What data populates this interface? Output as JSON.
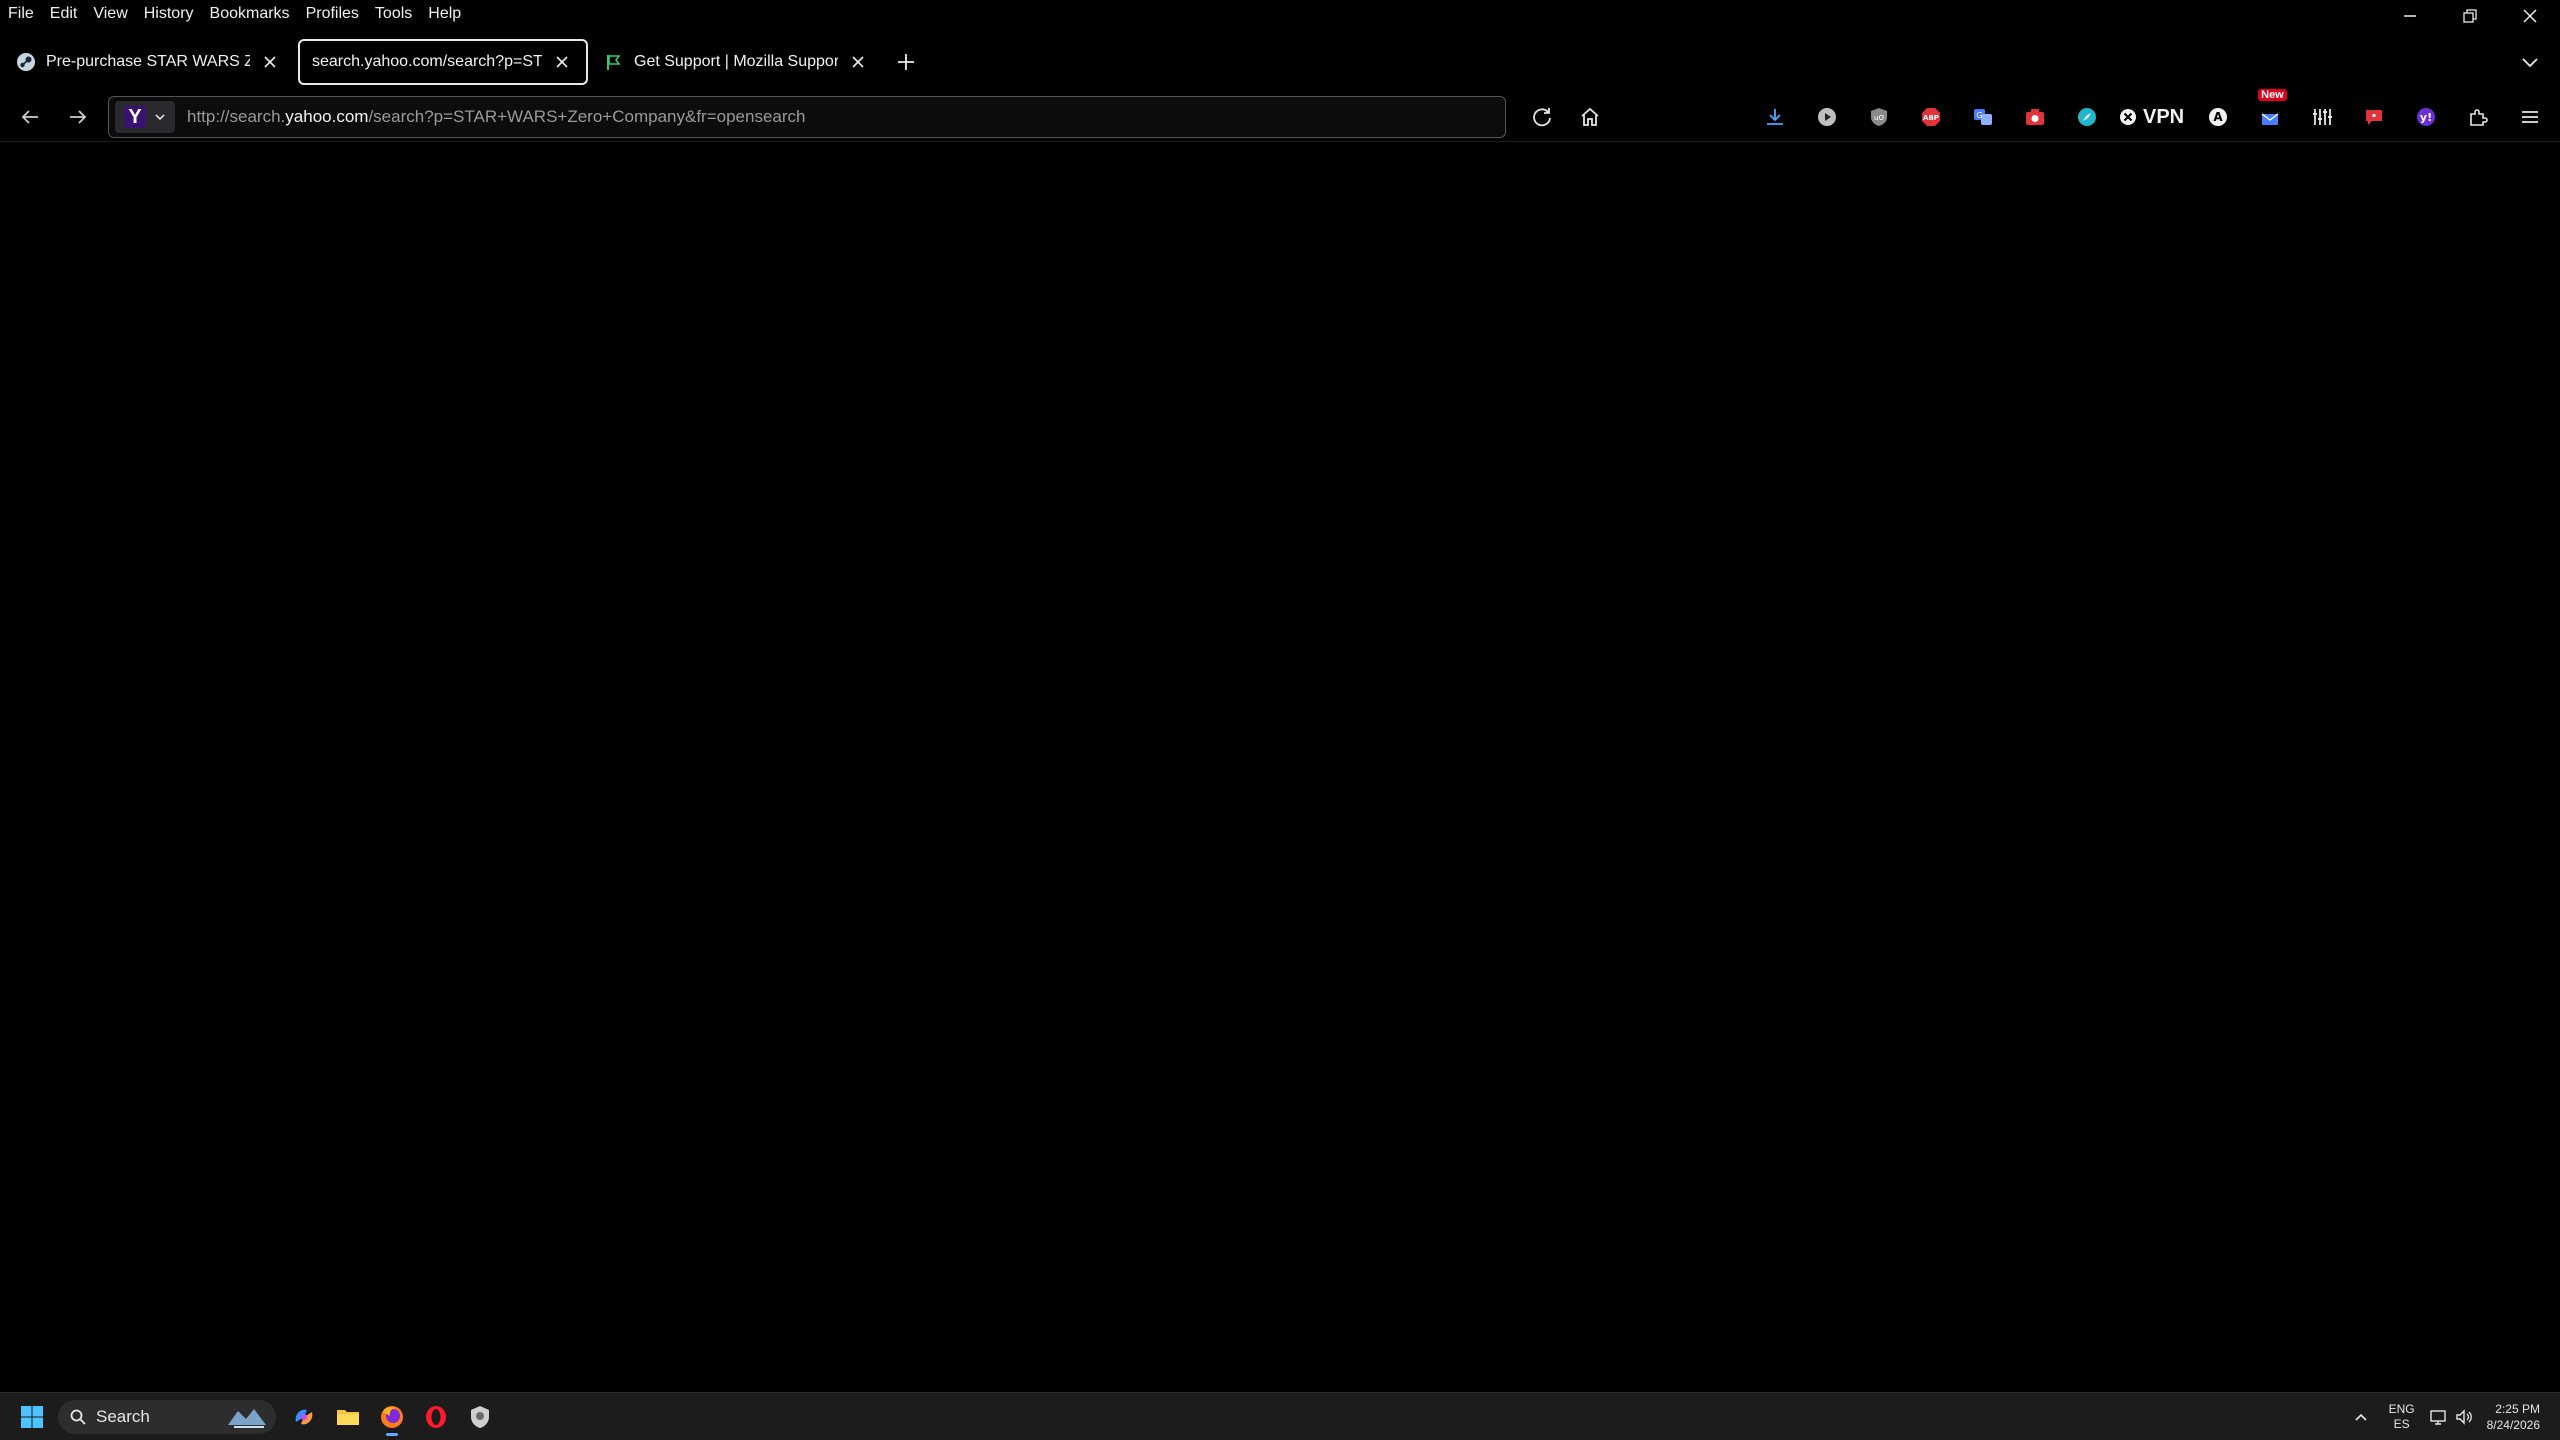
{
  "menu": {
    "items": [
      "File",
      "Edit",
      "View",
      "History",
      "Bookmarks",
      "Profiles",
      "Tools",
      "Help"
    ]
  },
  "tabs": [
    {
      "label": "Pre-purchase STAR WARS Zero C",
      "icon": "steam-icon"
    },
    {
      "label": "search.yahoo.com/search?p=STAR+W",
      "icon": "none",
      "active": true
    },
    {
      "label": "Get Support | Mozilla Support",
      "icon": "mozilla-support-icon"
    }
  ],
  "urlbar": {
    "prefix": "http://search.",
    "host": "yahoo.com",
    "rest": "/search?p=STAR+WARS+Zero+Company&fr=opensearch",
    "engine": "Y"
  },
  "toolbar": {
    "vpn_label": "VPN",
    "new_badge": "New"
  },
  "taskbar": {
    "search_label": "Search",
    "lang_top": "ENG",
    "lang_bottom": "ES",
    "time": "2:25 PM",
    "date": "8/24/2026"
  },
  "colors": {
    "background": "#000000",
    "taskbar": "#1c1c1c",
    "accent_blue": "#6aa8ff"
  }
}
